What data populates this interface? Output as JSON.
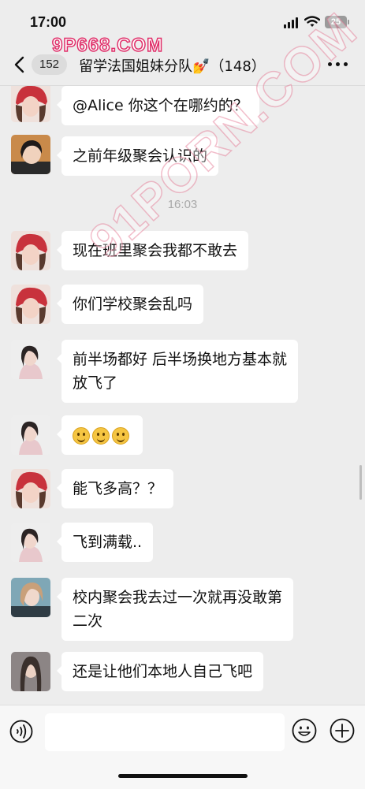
{
  "status_bar": {
    "time": "17:00",
    "battery": "25"
  },
  "watermark": {
    "top": "9P668.COM",
    "diagonal": "91PORN.COM"
  },
  "header": {
    "unread_count": "152",
    "title": "留学法国姐妹分队💅（148）"
  },
  "messages": [
    {
      "type": "text",
      "avatar": "red-hat-girl",
      "text": "@Alice 你这个在哪约的？"
    },
    {
      "type": "text",
      "avatar": "dark-hair-girl",
      "text": "之前年级聚会认识的"
    },
    {
      "type": "time",
      "text": "16:03"
    },
    {
      "type": "text",
      "avatar": "red-hat-girl",
      "text": "现在班里聚会我都不敢去"
    },
    {
      "type": "text",
      "avatar": "red-hat-girl",
      "text": "你们学校聚会乱吗"
    },
    {
      "type": "text",
      "avatar": "pink-hoodie-girl",
      "lines": [
        "前半场都好 后半场换地方基本就",
        "放飞了"
      ]
    },
    {
      "type": "emoji",
      "avatar": "pink-hoodie-girl",
      "emojis": [
        "smile-emoji",
        "smile-emoji",
        "smile-emoji"
      ]
    },
    {
      "type": "text",
      "avatar": "red-hat-girl",
      "text": "能飞多高？？"
    },
    {
      "type": "text",
      "avatar": "pink-hoodie-girl",
      "text": "飞到满载.."
    },
    {
      "type": "text",
      "avatar": "blonde-girl",
      "lines": [
        "校内聚会我去过一次就再没敢第",
        "二次"
      ]
    },
    {
      "type": "text",
      "avatar": "long-hair-girl",
      "text": "还是让他们本地人自己飞吧"
    }
  ],
  "avatar_colors": {
    "red-hat-girl": "#c8323c",
    "dark-hair-girl": "#c98a4a",
    "pink-hoodie-girl": "#e8c8cc",
    "blonde-girl": "#7fa7b6",
    "long-hair-girl": "#6f6a6a"
  }
}
